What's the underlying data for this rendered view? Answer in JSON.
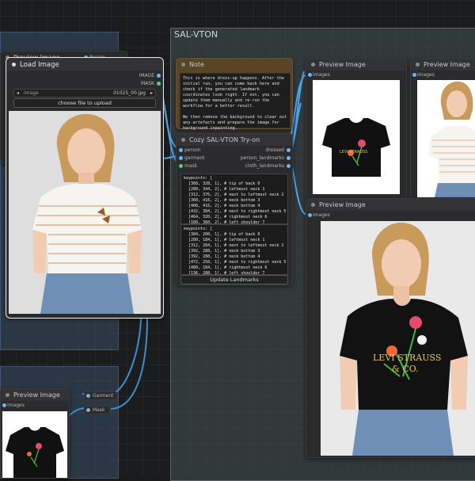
{
  "colors": {
    "wire": "#4da6ec",
    "note_head": "#5a4426",
    "note_border": "#6b5232"
  },
  "groups": {
    "sal_vton": "SAL-VTON"
  },
  "nodes": {
    "preview_top_left": {
      "title": "Preview Image",
      "input": "Person"
    },
    "load_image": {
      "title": "Load Image",
      "out_image": "IMAGE",
      "out_mask": "MASK",
      "image_label": "image",
      "image_value": "01025_00.jpg",
      "upload_button": "choose file to upload"
    },
    "note": {
      "title": "Note",
      "text": "This is where dress-up happens. After the initial run, you can come back here and check if the generated landmark coordinates look right. If not, you can update them manually and re-run the workflow for a better result.\n\nWe then remove the background to clear out any artefacts and prepare the image for background inpainting."
    },
    "cozy": {
      "title": "Cozy SAL-VTON Try-on",
      "in_person": "person",
      "in_garment": "garment",
      "in_mask": "mask",
      "out_dressed": "dressed",
      "out_person_landmarks": "person_landmarks",
      "out_cloth_landmarks": "cloth_landmarks",
      "keypoints_a": "keypoints: [\n  [368, 328, 1], # tip of back 0\n  [280, 344, 2], # leftmost neck 1\n  [312, 376, 2], # next to leftmost neck 2\n  [360, 416, 2], # neck bottom 3\n  [408, 416, 2], # neck bottom 4\n  [432, 384, 2], # next to rightmost neck 5\n  [464, 320, 2], # rightmost neck 6\n  [180, 360, 2], # left shoulder 7",
      "keypoints_b": "keypoints: [\n  [384, 200, 1], # tip of back 0\n  [280, 184, 1], # leftmost neck 1\n  [312, 264, 1], # next to leftmost neck 2\n  [392, 288, 1], # neck bottom 3\n  [392, 288, 1], # neck bottom 4\n  [472, 256, 1], # next to rightmost neck 5\n  [480, 184, 1], # rightmost neck 6\n  [136, 288, 1], # left shoulder 7",
      "update_button": "Update Landmarks"
    },
    "preview_a": {
      "title": "Preview Image",
      "input": "images"
    },
    "preview_b": {
      "title": "Preview Image",
      "input": "images"
    },
    "preview_c": {
      "title": "Preview Image",
      "input": "images"
    },
    "preview_bottom_left": {
      "title": "Preview Image",
      "input": "images",
      "garment_label": "Garment",
      "mask_label": "Mask"
    }
  },
  "shirt_print": {
    "line1": "LEVI STRAUSS",
    "line2": "& CO."
  }
}
